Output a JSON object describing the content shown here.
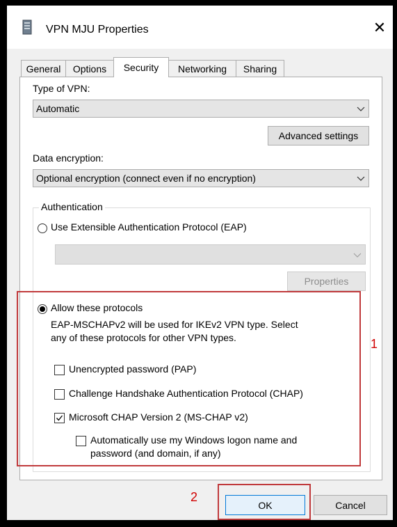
{
  "window": {
    "title": "VPN MJU Properties",
    "close_symbol": "✕"
  },
  "tabs": [
    {
      "label": "General",
      "active": false
    },
    {
      "label": "Options",
      "active": false
    },
    {
      "label": "Security",
      "active": true
    },
    {
      "label": "Networking",
      "active": false
    },
    {
      "label": "Sharing",
      "active": false
    }
  ],
  "security": {
    "vpn_type_label": "Type of VPN:",
    "vpn_type_value": "Automatic",
    "advanced_settings_label": "Advanced settings",
    "data_encryption_label": "Data encryption:",
    "data_encryption_value": "Optional encryption (connect even if no encryption)",
    "authentication": {
      "group_label": "Authentication",
      "eap_option_label": "Use Extensible Authentication Protocol (EAP)",
      "eap_selected": false,
      "eap_method_value": "",
      "properties_label": "Properties",
      "allow_protocols_label": "Allow these protocols",
      "allow_protocols_selected": true,
      "note_line1": "EAP-MSCHAPv2 will be used for IKEv2 VPN type. Select",
      "note_line2": "any of these protocols for other VPN types.",
      "protocols": {
        "pap_label": "Unencrypted password (PAP)",
        "pap_checked": false,
        "chap_label": "Challenge Handshake Authentication Protocol (CHAP)",
        "chap_checked": false,
        "mschapv2_label": "Microsoft CHAP Version 2 (MS-CHAP v2)",
        "mschapv2_checked": true,
        "auto_logon_line1": "Automatically use my Windows logon name and",
        "auto_logon_line2": "password (and domain, if any)",
        "auto_logon_checked": false
      }
    }
  },
  "buttons": {
    "ok_label": "OK",
    "cancel_label": "Cancel"
  },
  "annotations": {
    "label1": "1",
    "label2": "2",
    "color": "#c0393b"
  }
}
